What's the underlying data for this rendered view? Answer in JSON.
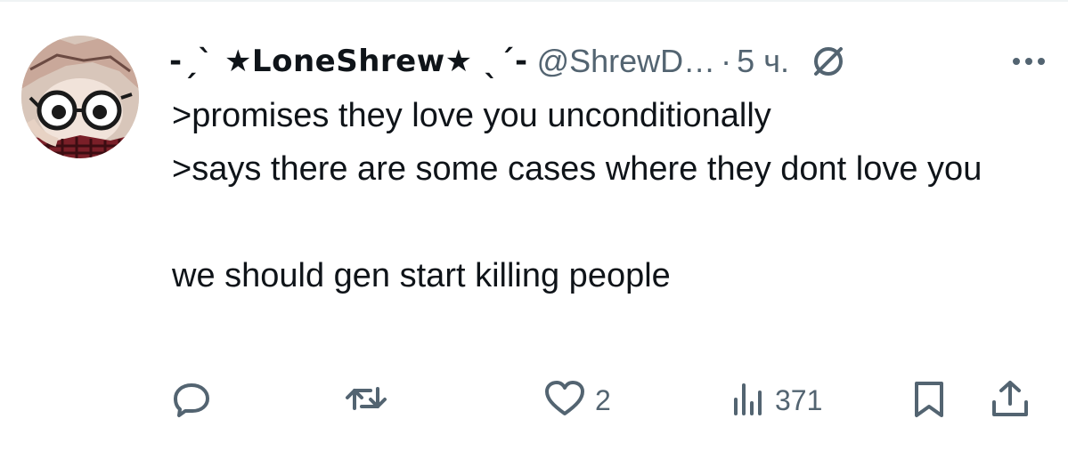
{
  "tweet": {
    "author": {
      "display_name": "-ˏˋ ★LoneShrew★ ˎˊ-",
      "handle": "@ShrewD…",
      "avatar": "avatar-image",
      "badge": "slashed-circle-icon"
    },
    "separator": "·",
    "timestamp": "5 ч.",
    "text_lines": [
      ">promises they love you unconditionally",
      ">says there are some cases where they dont love you",
      "we should gen start killing people"
    ],
    "actions": {
      "reply": {
        "icon": "reply-icon",
        "count": ""
      },
      "retweet": {
        "icon": "retweet-icon",
        "count": ""
      },
      "like": {
        "icon": "heart-icon",
        "count": "2"
      },
      "views": {
        "icon": "views-icon",
        "count": "371"
      },
      "bookmark": {
        "icon": "bookmark-icon"
      },
      "share": {
        "icon": "share-icon"
      }
    }
  },
  "colors": {
    "text": "#0f1419",
    "secondary": "#536471",
    "divider": "#eff3f4"
  }
}
